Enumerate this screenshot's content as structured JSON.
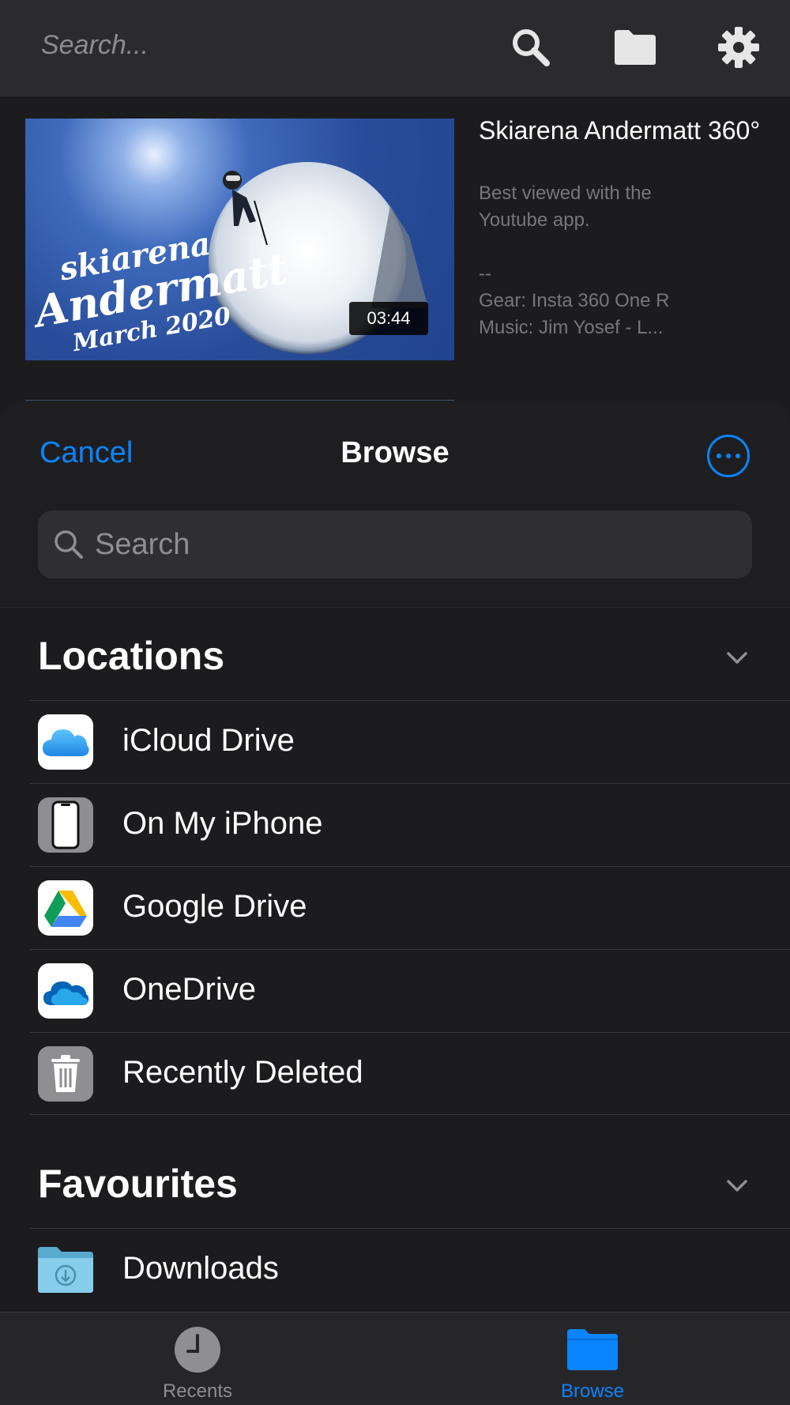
{
  "top_bar": {
    "search_placeholder": "Search...",
    "icons": [
      "search-icon",
      "folder-icon",
      "gear-icon"
    ]
  },
  "video": {
    "title": "Skiarena Andermatt 360°",
    "duration": "03:44",
    "description": "Best viewed with the\nYoutube app.\n\n--\nGear: Insta 360 One R\nMusic: Jim Yosef - L...",
    "thumbnail_text": [
      "skiarena",
      "Andermatt",
      "March 2020"
    ]
  },
  "sheet": {
    "cancel_label": "Cancel",
    "title": "Browse",
    "more_icon": "ellipsis-circle-icon",
    "search_placeholder": "Search"
  },
  "locations": {
    "title": "Locations",
    "items": [
      {
        "label": "iCloud Drive",
        "icon": "icloud-drive-icon"
      },
      {
        "label": "On My iPhone",
        "icon": "iphone-icon"
      },
      {
        "label": "Google Drive",
        "icon": "google-drive-icon"
      },
      {
        "label": "OneDrive",
        "icon": "onedrive-icon"
      },
      {
        "label": "Recently Deleted",
        "icon": "trash-icon"
      }
    ]
  },
  "favourites": {
    "title": "Favourites",
    "items": [
      {
        "label": "Downloads",
        "icon": "downloads-folder-icon"
      }
    ]
  },
  "tab_bar": {
    "tabs": [
      {
        "label": "Recents",
        "icon": "clock-icon",
        "active": false
      },
      {
        "label": "Browse",
        "icon": "folder-icon",
        "active": true
      }
    ]
  },
  "colors": {
    "accent": "#0a84ff",
    "background": "#1c1c1e",
    "top_bar": "#2b2b2d",
    "inactive_tab": "#8e8e93"
  }
}
